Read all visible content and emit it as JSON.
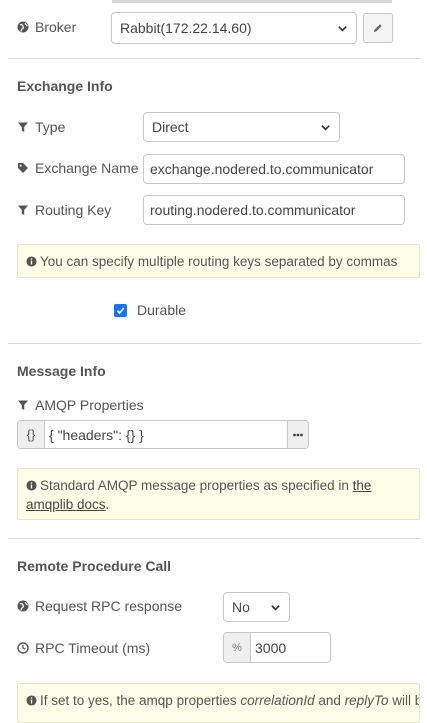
{
  "broker": {
    "label": "Broker",
    "value": "Rabbit(172.22.14.60)"
  },
  "exchange": {
    "title": "Exchange Info",
    "type_label": "Type",
    "type_value": "Direct",
    "name_label": "Exchange Name",
    "name_value": "exchange.nodered.to.communicator",
    "routing_label": "Routing Key",
    "routing_value": "routing.nodered.to.communicator",
    "tip": "You can specify multiple routing keys separated by commas",
    "durable_label": "Durable",
    "durable_checked": true
  },
  "message": {
    "title": "Message Info",
    "amqp_label": "AMQP Properties",
    "amqp_type": "{}",
    "amqp_value": "{ \"headers\": {} }",
    "tip_before": "Standard AMQP message properties as specified in ",
    "tip_link": "the amqplib docs",
    "tip_after": "."
  },
  "rpc": {
    "title": "Remote Procedure Call",
    "request_label": "Request RPC response",
    "request_value": "No",
    "timeout_label": "RPC Timeout (ms)",
    "timeout_type": "%",
    "timeout_value": "3000",
    "tip_text1": "If set to yes, the amqp properties ",
    "tip_code1": "correlationId",
    "tip_text2": " and ",
    "tip_code2": "replyTo",
    "tip_text3": " will be"
  },
  "colors": {
    "tip_bg": "#ffffe9",
    "checkbox_accent": "#1a73e8"
  }
}
